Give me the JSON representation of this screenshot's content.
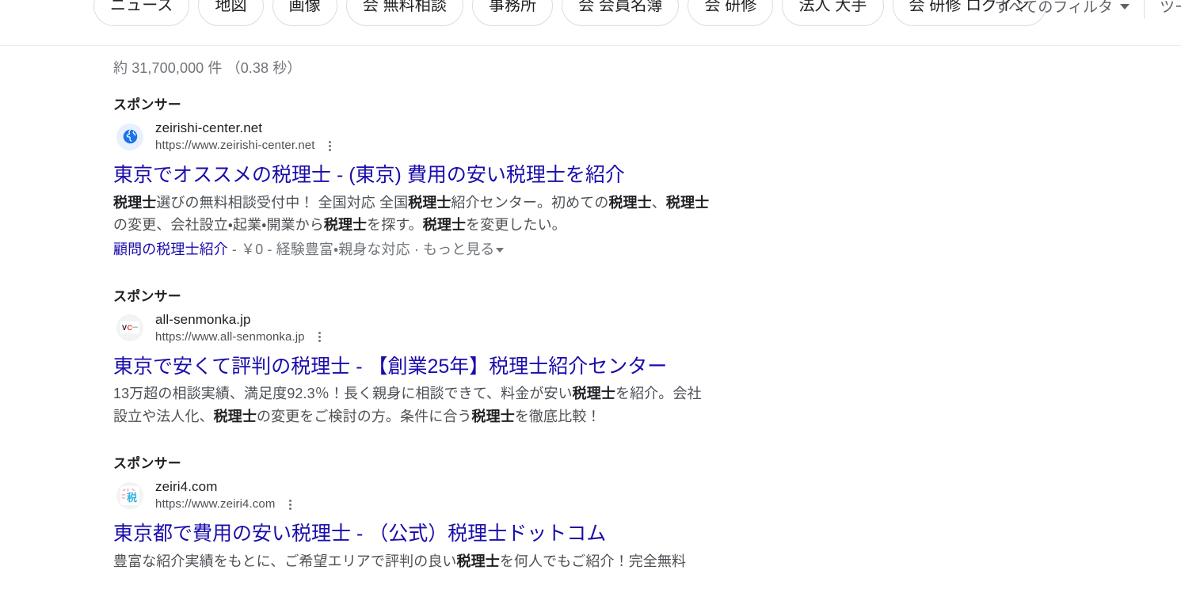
{
  "filter_bar": {
    "chips": [
      {
        "label": "ニュース",
        "name": "filter-chip-news"
      },
      {
        "label": "地図",
        "name": "filter-chip-maps"
      },
      {
        "label": "画像",
        "name": "filter-chip-images"
      },
      {
        "label": "会 無料相談",
        "name": "filter-chip-free-consultation"
      },
      {
        "label": "事務所",
        "name": "filter-chip-office"
      },
      {
        "label": "会 会員名簿",
        "name": "filter-chip-member-list"
      },
      {
        "label": "会 研修",
        "name": "filter-chip-training"
      },
      {
        "label": "法人 大手",
        "name": "filter-chip-major-corporations"
      },
      {
        "label": "会 研修 ログイン",
        "name": "filter-chip-training-login"
      }
    ],
    "all_filters_label": "すべてのフィルタ",
    "tools_label": "ツール",
    "caret_icon": "chevron-down-icon",
    "divider_color": "#dadce0"
  },
  "result_stats": "約 31,700,000 件 （0.38 秒）",
  "sponsor_label": "スポンサー",
  "kebab_icon": "three-dot-menu-icon",
  "colors": {
    "link": "#1a0dab",
    "text": "#202124",
    "muted": "#4d5156",
    "gray": "#70757a",
    "chip_border": "#dadce0"
  },
  "ads": [
    {
      "sponsor": "スポンサー",
      "favicon": {
        "type": "globe-icon",
        "bg": "#e8f0fe",
        "fg": "#1a73e8"
      },
      "site_name": "zeirishi-center.net",
      "url": "https://www.zeirishi-center.net",
      "title": "東京でオススメの税理士 - (東京) 費用の安い税理士を紹介",
      "description_parts": [
        {
          "t": "税理士",
          "b": true
        },
        {
          "t": "選びの無料相談受付中！ 全国対応 全国",
          "b": false
        },
        {
          "t": "税理士",
          "b": true
        },
        {
          "t": "紹介センター。初めての",
          "b": false
        },
        {
          "t": "税理士",
          "b": true
        },
        {
          "t": "、",
          "b": false
        },
        {
          "t": "税理士",
          "b": true
        },
        {
          "t": "の変更、会社設立・起業・開業から",
          "b": false
        },
        {
          "t": "税理士",
          "b": true
        },
        {
          "t": "を探す。",
          "b": false
        },
        {
          "t": "税理士",
          "b": true
        },
        {
          "t": "を変更したい。",
          "b": false
        }
      ],
      "sitelinks": {
        "link_text": "顧問の税理士紹介",
        "rest": " - ￥0 - 経験豊富・親身な対応 · もっと見る",
        "has_caret": true
      }
    },
    {
      "sponsor": "スポンサー",
      "favicon": {
        "type": "vc-logo-icon",
        "bg": "#f1f3f4",
        "fg": "#202124",
        "accent": "#e8342a",
        "text": "VC"
      },
      "site_name": "all-senmonka.jp",
      "url": "https://www.all-senmonka.jp",
      "title": "東京で安くて評判の税理士 - 【創業25年】税理士紹介センター",
      "description_parts": [
        {
          "t": "13万超の相談実績、満足度92.3％！長く親身に相談できて、料金が安い",
          "b": false
        },
        {
          "t": "税理士",
          "b": true
        },
        {
          "t": "を紹介。会社設立や法人化、",
          "b": false
        },
        {
          "t": "税理士",
          "b": true
        },
        {
          "t": "の変更をご検討の方。条件に合う",
          "b": false
        },
        {
          "t": "税理士",
          "b": true
        },
        {
          "t": "を徹底比較！",
          "b": false
        }
      ],
      "sitelinks": null
    },
    {
      "sponsor": "スポンサー",
      "favicon": {
        "type": "zei-kanji-icon",
        "bg": "#f1f3f4",
        "fg": "#2eb5e0",
        "accent": "#f8b9cc",
        "text": "税"
      },
      "site_name": "zeiri4.com",
      "url": "https://www.zeiri4.com",
      "title": "東京都で費用の安い税理士 - （公式）税理士ドットコム",
      "description_parts": [
        {
          "t": "豊富な紹介実績をもとに、ご希望エリアで評判の良い",
          "b": false
        },
        {
          "t": "税理士",
          "b": true
        },
        {
          "t": "を何人でもご紹介！完全無料",
          "b": false
        }
      ],
      "sitelinks": null
    }
  ]
}
